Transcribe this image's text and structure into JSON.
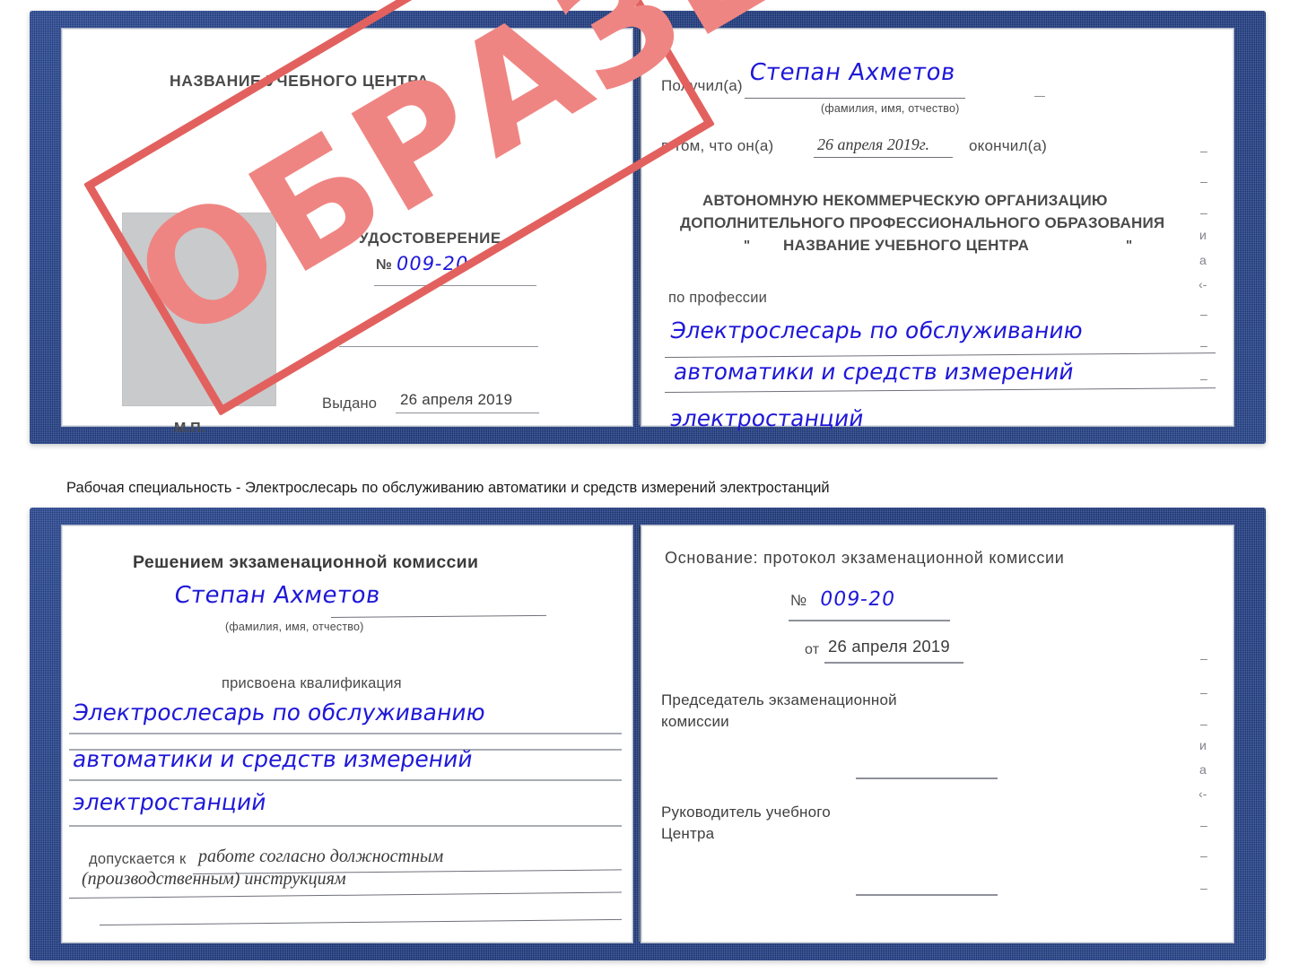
{
  "document": {
    "title": "Удостоверение — образец",
    "stamp_text": "ОБРАЗЕЦ",
    "accent_blue": "#1f18d8",
    "cover_blue": "#24448f",
    "stamp_red": "#e2615e"
  },
  "caption": {
    "text": "Рабочая специальность - Электрослесарь по обслуживанию автоматики и средств измерений электростанций"
  },
  "cert1": {
    "left": {
      "center_name_heading": "НАЗВАНИЕ УЧЕБНОГО ЦЕНТРА",
      "doc_type": "УДОСТОВЕРЕНИЕ",
      "number_label": "№",
      "number_value": "009-20",
      "issued_label": "Выдано",
      "issued_date": "26 апреля 2019",
      "seal_label": "М.П."
    },
    "right": {
      "received_label": "Получил(а)",
      "received_name": "Степан Ахметов",
      "name_hint": "(фамилия, имя, отчество)",
      "in_that_label": "в том, что он(а)",
      "completion_date": "26 апреля 2019г.",
      "finished_label": "окончил(а)",
      "org_line1": "АВТОНОМНУЮ НЕКОММЕРЧЕСКУЮ ОРГАНИЗАЦИЮ",
      "org_line2": "ДОПОЛНИТЕЛЬНОГО ПРОФЕССИОНАЛЬНОГО ОБРАЗОВАНИЯ",
      "org_quote_open": "\"",
      "org_name": "НАЗВАНИЕ УЧЕБНОГО ЦЕНТРА",
      "org_quote_close": "\"",
      "profession_label": "по профессии",
      "profession_line1": "Электрослесарь по обслуживанию",
      "profession_line2": "автоматики и средств измерений",
      "profession_line3": "электростанций"
    }
  },
  "cert2": {
    "left": {
      "commission_heading": "Решением экзаменационной комиссии",
      "name": "Степан Ахметов",
      "name_hint": "(фамилия, имя, отчество)",
      "qualification_label": "присвоена квалификация",
      "qualification_line1": "Электрослесарь по обслуживанию",
      "qualification_line2": "автоматики и средств измерений",
      "qualification_line3": "электростанций",
      "admitted_label": "допускается к",
      "admitted_line1": "работе согласно должностным",
      "admitted_line2": "(производственным) инструкциям"
    },
    "right": {
      "basis_label": "Основание: протокол экзаменационной комиссии",
      "number_label": "№",
      "number_value": "009-20",
      "from_label": "от",
      "from_date": "26 апреля 2019",
      "chairman_line1": "Председатель экзаменационной",
      "chairman_line2": "комиссии",
      "head_line1": "Руководитель учебного",
      "head_line2": "Центра"
    }
  },
  "ghost_marks": {
    "m1": "–",
    "m2": "–",
    "m3": "–",
    "m4": "и",
    "m5": "а",
    "m6": "‹-",
    "m7": "–",
    "m8": "–",
    "m9": "–"
  }
}
